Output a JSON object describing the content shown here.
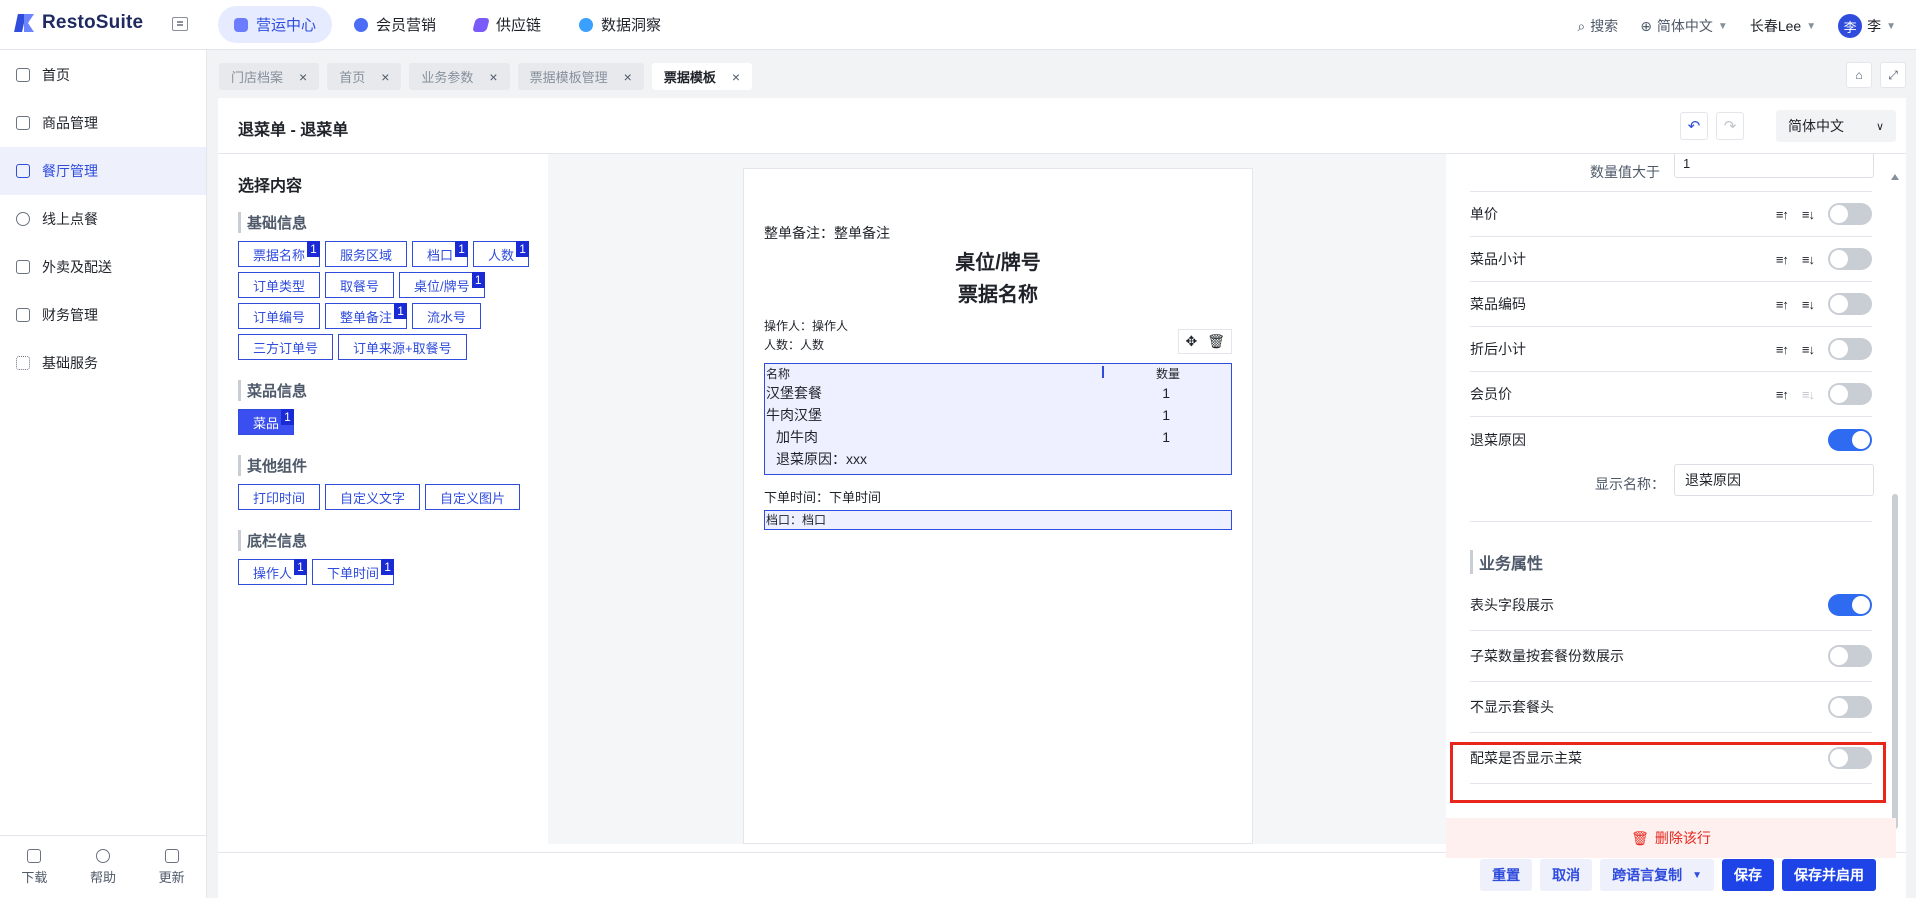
{
  "app": {
    "logo_text": "RestoSuite"
  },
  "topnav": [
    {
      "label": "营运中心",
      "active": true,
      "color": "#6b7cff"
    },
    {
      "label": "会员营销",
      "active": false,
      "color": "#4a6cf7"
    },
    {
      "label": "供应链",
      "active": false,
      "color": "#7a5af8"
    },
    {
      "label": "数据洞察",
      "active": false,
      "color": "#3aa0ff"
    }
  ],
  "topright": {
    "search": "搜索",
    "language": "简体中文",
    "store": "长春Lee",
    "avatar_char": "李",
    "user": "李"
  },
  "sidebar": {
    "items": [
      {
        "label": "首页",
        "icon": "home-icon",
        "active": false
      },
      {
        "label": "商品管理",
        "icon": "box-icon",
        "active": false
      },
      {
        "label": "餐厅管理",
        "icon": "store-icon",
        "active": true
      },
      {
        "label": "线上点餐",
        "icon": "hand-icon",
        "active": false
      },
      {
        "label": "外卖及配送",
        "icon": "bag-icon",
        "active": false
      },
      {
        "label": "财务管理",
        "icon": "folder-icon",
        "active": false
      },
      {
        "label": "基础服务",
        "icon": "grid-icon",
        "active": false
      }
    ],
    "bottom": [
      {
        "label": "下载",
        "icon": "download-icon"
      },
      {
        "label": "帮助",
        "icon": "help-icon"
      },
      {
        "label": "更新",
        "icon": "update-icon"
      }
    ]
  },
  "tabs": [
    {
      "label": "门店档案",
      "active": false
    },
    {
      "label": "首页",
      "active": false
    },
    {
      "label": "业务参数",
      "active": false
    },
    {
      "label": "票据模板管理",
      "active": false
    },
    {
      "label": "票据模板",
      "active": true
    }
  ],
  "page": {
    "title": "退菜单 - 退菜单",
    "language": "简体中文"
  },
  "left": {
    "title": "选择内容",
    "sections": [
      {
        "title": "基础信息",
        "chips": [
          {
            "label": "票据名称",
            "badge": "1"
          },
          {
            "label": "服务区域",
            "badge": ""
          },
          {
            "label": "档口",
            "badge": "1"
          },
          {
            "label": "人数",
            "badge": "1"
          },
          {
            "label": "订单类型",
            "badge": ""
          },
          {
            "label": "取餐号",
            "badge": ""
          },
          {
            "label": "桌位/牌号",
            "badge": "1"
          },
          {
            "label": "订单编号",
            "badge": ""
          },
          {
            "label": "整单备注",
            "badge": "1"
          },
          {
            "label": "流水号",
            "badge": ""
          },
          {
            "label": "三方订单号",
            "badge": ""
          },
          {
            "label": "订单来源+取餐号",
            "badge": ""
          }
        ]
      },
      {
        "title": "菜品信息",
        "chips": [
          {
            "label": "菜品",
            "badge": "1",
            "filled": true
          }
        ]
      },
      {
        "title": "其他组件",
        "chips": [
          {
            "label": "打印时间",
            "badge": ""
          },
          {
            "label": "自定义文字",
            "badge": ""
          },
          {
            "label": "自定义图片",
            "badge": ""
          }
        ]
      },
      {
        "title": "底栏信息",
        "chips": [
          {
            "label": "操作人",
            "badge": "1"
          },
          {
            "label": "下单时间",
            "badge": "1"
          }
        ]
      }
    ]
  },
  "receipt": {
    "remark": "整单备注：整单备注",
    "table_no": "桌位/牌号",
    "bill_name": "票据名称",
    "operator": "操作人：操作人",
    "people": "人数：人数",
    "col_name": "名称",
    "col_qty": "数量",
    "rows": [
      {
        "name": "汉堡套餐",
        "qty": "1"
      },
      {
        "name": "牛肉汉堡",
        "qty": "1"
      },
      {
        "name": "加牛肉",
        "qty": "1"
      }
    ],
    "return_reason": "退菜原因：xxx",
    "order_time": "下单时间：下单时间",
    "stall": "档口：档口"
  },
  "right": {
    "top_field_label": "数量值大于",
    "top_field_value": "1",
    "rows": [
      {
        "label": "单价",
        "sort_up_enabled": true,
        "sort_down_enabled": true,
        "on": false
      },
      {
        "label": "菜品小计",
        "sort_up_enabled": true,
        "sort_down_enabled": true,
        "on": false
      },
      {
        "label": "菜品编码",
        "sort_up_enabled": true,
        "sort_down_enabled": true,
        "on": false
      },
      {
        "label": "折后小计",
        "sort_up_enabled": true,
        "sort_down_enabled": true,
        "on": false
      },
      {
        "label": "会员价",
        "sort_up_enabled": true,
        "sort_down_enabled": false,
        "on": false
      }
    ],
    "return_reason": {
      "label": "退菜原因",
      "on": true,
      "display_name_label": "显示名称：",
      "display_name_value": "退菜原因"
    },
    "business_section": "业务属性",
    "business_rows": [
      {
        "label": "表头字段展示",
        "on": true
      },
      {
        "label": "子菜数量按套餐份数展示",
        "on": false
      },
      {
        "label": "不显示套餐头",
        "on": false
      },
      {
        "label": "配菜是否显示主菜",
        "on": false
      }
    ],
    "delete_row": "删除该行"
  },
  "footer": {
    "reset": "重置",
    "cancel": "取消",
    "cross_copy": "跨语言复制",
    "save": "保存",
    "save_enable": "保存并启用"
  }
}
